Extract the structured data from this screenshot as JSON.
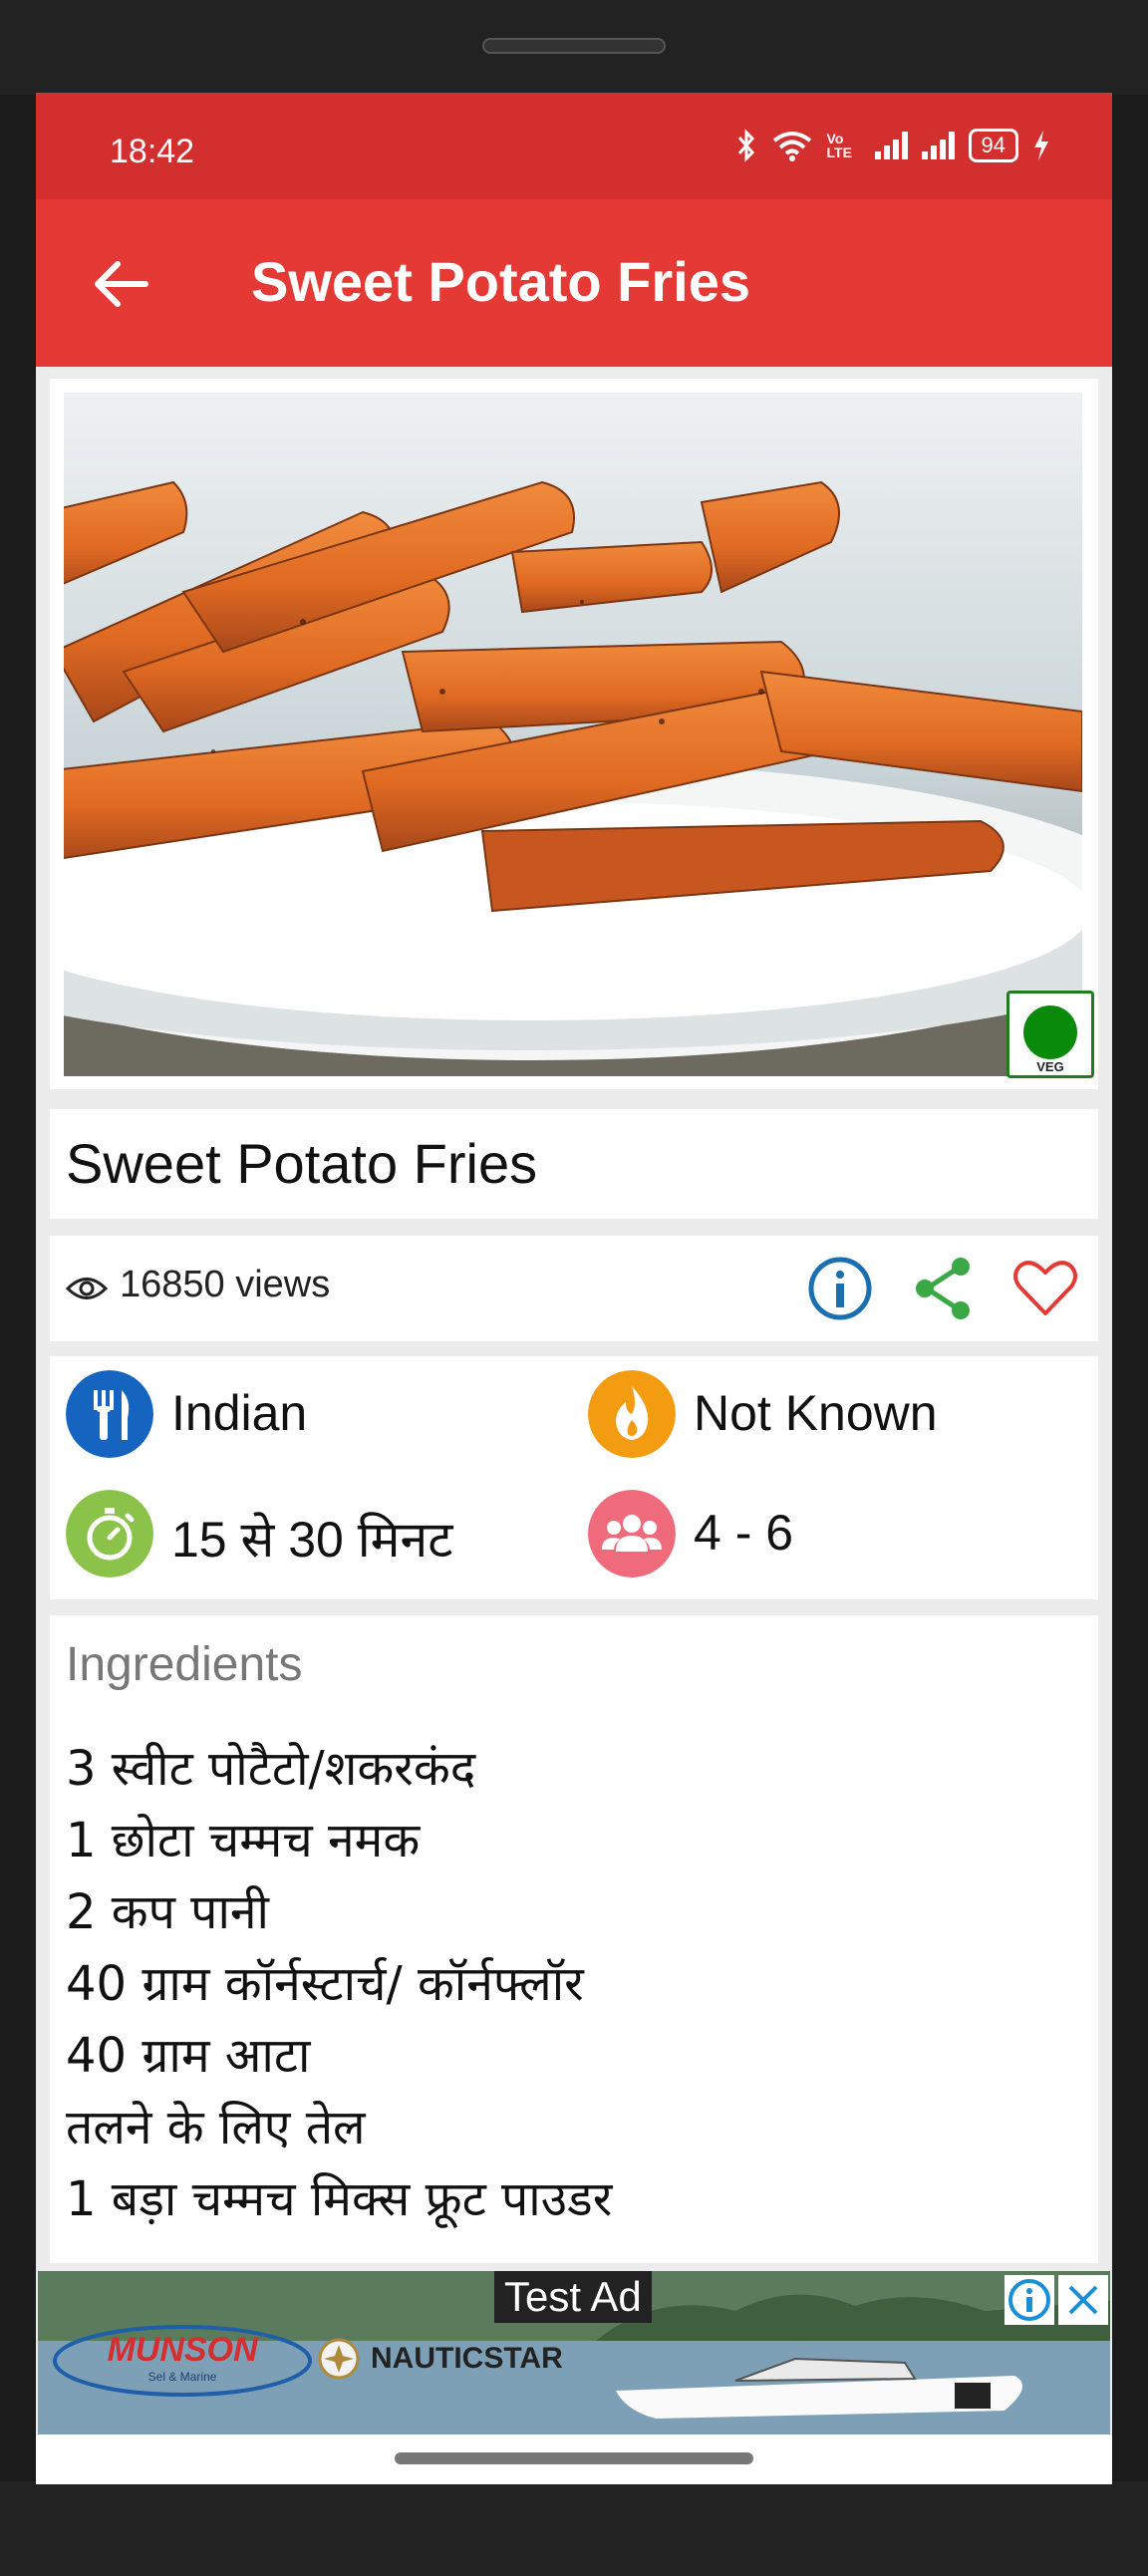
{
  "status_bar": {
    "time": "18:42",
    "network_label": "Vo LTE",
    "battery": "94"
  },
  "toolbar": {
    "title": "Sweet Potato Fries"
  },
  "recipe": {
    "veg_badge": "VEG",
    "title": "Sweet Potato Fries",
    "views": "16850 views",
    "cuisine": "Indian",
    "difficulty": "Not Known",
    "time": "15 से 30 मिनट",
    "servings": "4 - 6",
    "ingredients_heading": "Ingredients",
    "ingredients": [
      "3 स्वीट पोटैटो/शकरकंद",
      "1 छोटा चम्मच नमक",
      "2 कप पानी",
      "40 ग्राम कॉर्नस्टार्च/ कॉर्नफ्लॉर",
      "40 ग्राम आटा",
      "तलने के लिए तेल",
      "1 बड़ा चम्मच मिक्स फ्रूट पाउडर"
    ]
  },
  "ad": {
    "label": "Test Ad",
    "brand_left": "MUNSON",
    "brand_left_sub": "Sel & Marine",
    "brand_right": "NAUTICSTAR"
  },
  "icons": {
    "back": "arrow-left-icon",
    "eye": "eye-icon",
    "info": "info-icon",
    "share": "share-icon",
    "favorite": "heart-icon",
    "cuisine": "fork-knife-icon",
    "difficulty": "flame-icon",
    "time": "stopwatch-icon",
    "servings": "people-icon"
  },
  "colors": {
    "status_bar": "#d32f2f",
    "toolbar": "#e53935",
    "cuisine_icon": "#1565c0",
    "difficulty_icon": "#f39c12",
    "time_icon": "#8bc34a",
    "servings_icon": "#ef6a7a",
    "share": "#3aa845",
    "favorite": "#e53935",
    "info": "#1a6fb0",
    "veg": "#0a8a0a"
  }
}
